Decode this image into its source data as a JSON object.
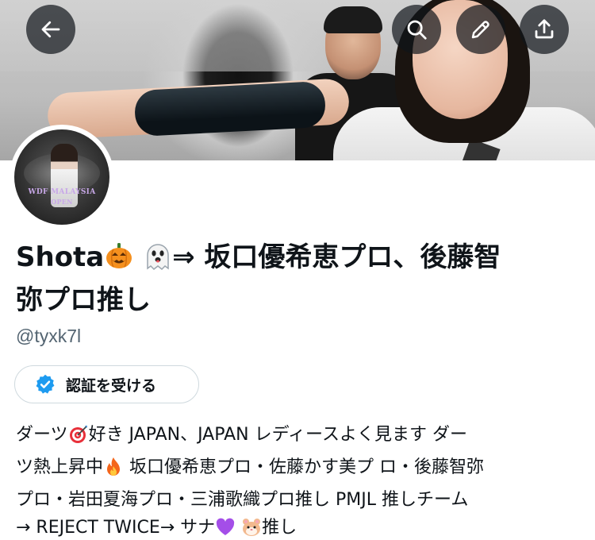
{
  "header": {
    "back_icon": "arrow-left-icon",
    "search_icon": "search-icon",
    "edit_icon": "pencil-icon",
    "share_icon": "upload-icon"
  },
  "avatar": {
    "text_line1": "WDF MALAYSIA",
    "text_line2": "OPEN"
  },
  "profile": {
    "name_part1": "Shota",
    "name_part2": "⇒ 坂口優希恵プロ、後藤智",
    "name_part3": "弥プロ推し",
    "name_emojis": [
      "jack-o-lantern-icon",
      "ghost-icon"
    ],
    "handle": "@tyxk7l"
  },
  "verify": {
    "label": "認証を受ける",
    "icon": "verified-badge-icon",
    "badge_color": "#1d9bf0"
  },
  "bio": {
    "line1_a": "ダーツ",
    "line1_b": "好き JAPAN、JAPAN レディースよく見ます ダー",
    "line2_a": "ツ熱上昇中",
    "line2_b": " 坂口優希恵プロ・佐藤かす美プ ロ・後藤智弥",
    "line3": "プロ・岩田夏海プロ・三浦歌織プロ推し PMJL 推しチーム",
    "line4_a": "→ REJECT TWICE→ サナ",
    "line4_b": "推し",
    "emojis": [
      "dart-icon",
      "fire-icon",
      "purple-heart-icon",
      "hamster-icon"
    ]
  }
}
